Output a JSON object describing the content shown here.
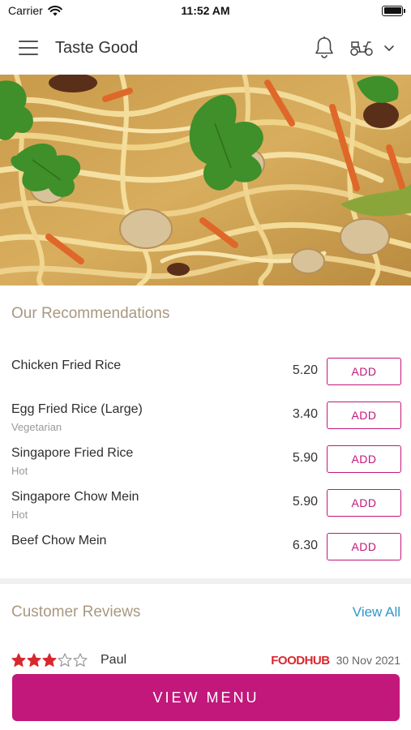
{
  "status_bar": {
    "carrier": "Carrier",
    "time": "11:52 AM"
  },
  "header": {
    "title": "Taste Good"
  },
  "recommendations": {
    "title": "Our Recommendations",
    "add_label": "ADD",
    "items": [
      {
        "name": "Chicken Fried Rice",
        "sub": "",
        "price": "5.20"
      },
      {
        "name": "Egg Fried Rice (Large)",
        "sub": "Vegetarian",
        "price": "3.40"
      },
      {
        "name": "Singapore Fried Rice",
        "sub": "Hot",
        "price": "5.90"
      },
      {
        "name": "Singapore Chow Mein",
        "sub": "Hot",
        "price": "5.90"
      },
      {
        "name": "Beef Chow Mein",
        "sub": "",
        "price": "6.30"
      }
    ]
  },
  "reviews": {
    "title": "Customer Reviews",
    "view_all": "View All",
    "first": {
      "reviewer": "Paul",
      "rating": 3,
      "max_rating": 5,
      "source": "FOODHUB",
      "date": "30 Nov 2021"
    }
  },
  "footer": {
    "view_menu": "VIEW MENU"
  },
  "colors": {
    "accent": "#c2177b",
    "section_title": "#a89880",
    "link": "#3196c9",
    "star": "#d9272e"
  },
  "icons": [
    "wifi-icon",
    "battery-icon",
    "menu-icon",
    "bell-icon",
    "delivery-scooter-icon",
    "chevron-down-icon",
    "star-icon"
  ]
}
